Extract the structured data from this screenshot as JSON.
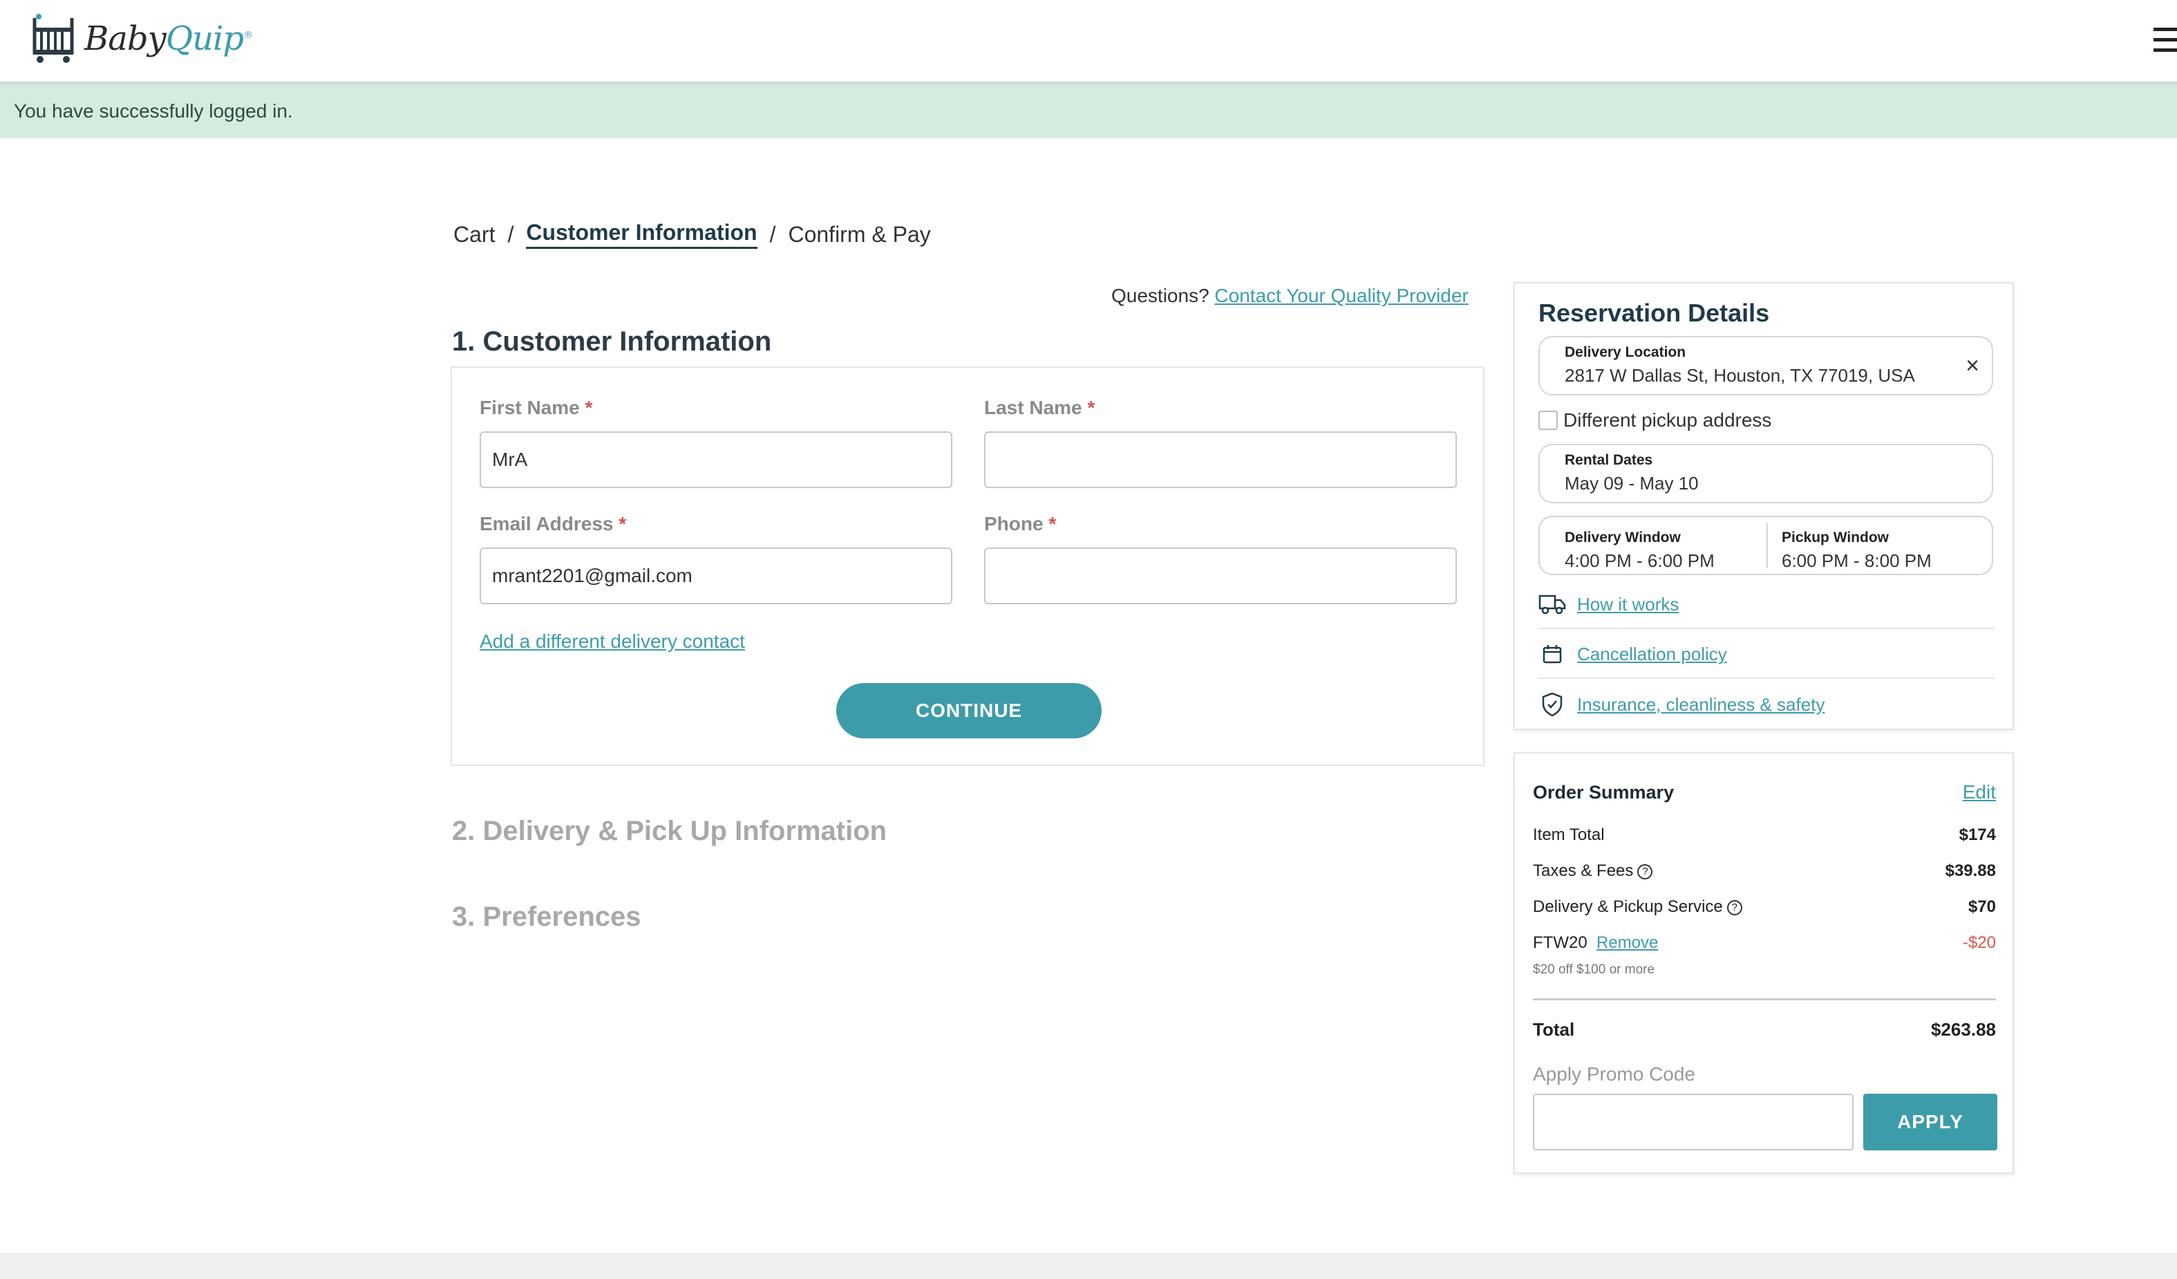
{
  "header": {
    "logo_baby": "Baby",
    "logo_quip": "Quip",
    "logo_reg": "®"
  },
  "alert": {
    "text": "You have successfully logged in."
  },
  "breadcrumb": {
    "cart": "Cart",
    "sep1": "/",
    "current": "Customer Information",
    "sep2": "/",
    "confirm": "Confirm & Pay"
  },
  "questions": {
    "prefix": "Questions?",
    "link": "Contact Your Quality Provider"
  },
  "sections": {
    "customer": "1. Customer Information",
    "delivery": "2. Delivery & Pick Up Information",
    "preferences": "3. Preferences"
  },
  "form": {
    "first_name_label": "First Name",
    "first_name_value": "MrA",
    "last_name_label": "Last Name",
    "last_name_value": "",
    "email_label": "Email Address",
    "email_value": "mrant2201@gmail.com",
    "phone_label": "Phone",
    "phone_value": "",
    "required_mark": "*",
    "add_contact_link": "Add a different delivery contact",
    "continue_label": "CONTINUE"
  },
  "reservation": {
    "title": "Reservation Details",
    "delivery_location_label": "Delivery Location",
    "delivery_location_value": "2817 W Dallas St, Houston, TX 77019, USA",
    "close_symbol": "×",
    "different_pickup_label": "Different pickup address",
    "rental_dates_label": "Rental Dates",
    "rental_dates_value": "May 09 - May 10",
    "delivery_window_label": "Delivery Window",
    "delivery_window_value": "4:00 PM - 6:00 PM",
    "pickup_window_label": "Pickup Window",
    "pickup_window_value": "6:00 PM - 8:00 PM",
    "links": [
      {
        "label": "How it works",
        "icon": "truck-icon"
      },
      {
        "label": "Cancellation policy",
        "icon": "calendar-icon"
      },
      {
        "label": "Insurance, cleanliness & safety",
        "icon": "shield-check-icon"
      }
    ]
  },
  "order_summary": {
    "title": "Order Summary",
    "edit_link": "Edit",
    "item_total_label": "Item Total",
    "item_total_value": "$174",
    "taxes_label": "Taxes & Fees",
    "taxes_value": "$39.88",
    "delivery_label": "Delivery & Pickup Service",
    "delivery_value": "$70",
    "promo_code": "FTW20",
    "remove_link": "Remove",
    "promo_value": "-$20",
    "promo_note": "$20 off $100 or more",
    "total_label": "Total",
    "total_value": "$263.88",
    "apply_promo_label": "Apply Promo Code",
    "apply_button": "APPLY"
  },
  "colors": {
    "accent": "#3d9ca9",
    "alert_bg": "#d4ebde",
    "negative": "#e0574d",
    "heading": "#1f3a4a"
  }
}
